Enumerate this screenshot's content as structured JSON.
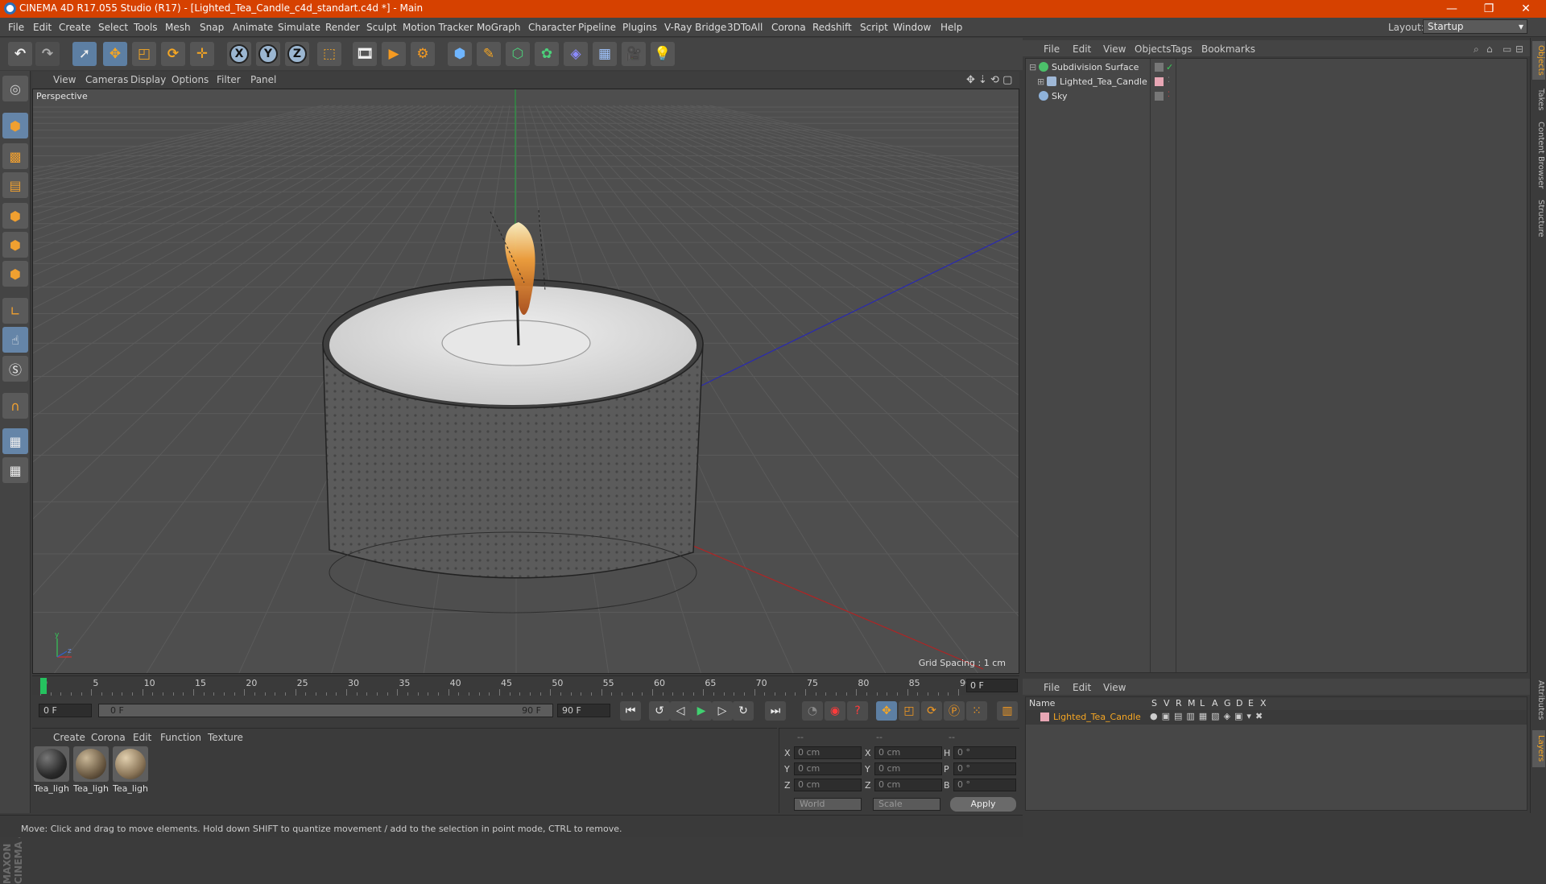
{
  "window": {
    "title": "CINEMA 4D R17.055 Studio (R17) - [Lighted_Tea_Candle_c4d_standart.c4d *] - Main",
    "minimize": "—",
    "restore": "❐",
    "close": "✕"
  },
  "menu": [
    "File",
    "Edit",
    "Create",
    "Select",
    "Tools",
    "Mesh",
    "Snap",
    "Animate",
    "Simulate",
    "Render",
    "Sculpt",
    "Motion Tracker",
    "MoGraph",
    "Character",
    "Pipeline",
    "Plugins",
    "V-Ray Bridge",
    "3DToAll",
    "Corona",
    "Redshift",
    "Script",
    "Window",
    "Help"
  ],
  "layout": {
    "label": "Layout:",
    "value": "Startup"
  },
  "viewport": {
    "menu": [
      "View",
      "Cameras",
      "Display",
      "Options",
      "Filter",
      "Panel"
    ],
    "label": "Perspective",
    "grid_spacing": "Grid Spacing : 1 cm"
  },
  "timeline": {
    "ticks": [
      "0",
      "5",
      "10",
      "15",
      "20",
      "25",
      "30",
      "35",
      "40",
      "45",
      "50",
      "55",
      "60",
      "65",
      "70",
      "75",
      "80",
      "85",
      "90"
    ],
    "current_frame": "0 F"
  },
  "transport": {
    "start": "0 F",
    "slider_start": "0 F",
    "slider_end": "90 F",
    "end": "90 F"
  },
  "material_panel": {
    "menu": [
      "Create",
      "Corona",
      "Edit",
      "Function",
      "Texture"
    ],
    "materials": [
      {
        "label": "Tea_ligh",
        "color": "#2a2a2a"
      },
      {
        "label": "Tea_ligh",
        "color": "#6b5a43"
      },
      {
        "label": "Tea_ligh",
        "color": "#8a7558"
      }
    ]
  },
  "coords": {
    "headers": [
      "--",
      "--",
      "--"
    ],
    "rows": [
      {
        "a": "X",
        "av": "0 cm",
        "b": "X",
        "bv": "0 cm",
        "c": "H",
        "cv": "0 °"
      },
      {
        "a": "Y",
        "av": "0 cm",
        "b": "Y",
        "bv": "0 cm",
        "c": "P",
        "cv": "0 °"
      },
      {
        "a": "Z",
        "av": "0 cm",
        "b": "Z",
        "bv": "0 cm",
        "c": "B",
        "cv": "0 °"
      }
    ],
    "space": "World",
    "mode": "Scale",
    "apply": "Apply"
  },
  "status": "Move: Click and drag to move elements. Hold down SHIFT to quantize movement / add to the selection in point mode, CTRL to remove.",
  "objects": {
    "menu": [
      "File",
      "Edit",
      "View",
      "Objects",
      "Tags",
      "Bookmarks"
    ],
    "items": [
      {
        "name": "Subdivision Surface",
        "icon_color": "#4cc06a"
      },
      {
        "name": "Lighted_Tea_Candle",
        "icon_color": "#9fb8d6"
      },
      {
        "name": "Sky",
        "icon_color": "#8fb3db"
      }
    ]
  },
  "layers": {
    "menu": [
      "File",
      "Edit",
      "View"
    ],
    "columns": [
      "Name",
      "S",
      "V",
      "R",
      "M",
      "L",
      "A",
      "G",
      "D",
      "E",
      "X"
    ],
    "row": "Lighted_Tea_Candle",
    "row_color": "#f5a623"
  },
  "side_tabs": [
    "Objects",
    "Takes",
    "Content Browser",
    "Structure",
    "Attributes",
    "Layers"
  ],
  "brand": "MAXON CINEMA 4D"
}
